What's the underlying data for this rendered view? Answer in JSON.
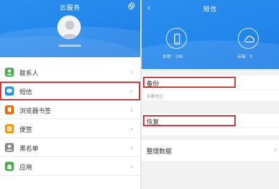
{
  "left_panel": {
    "title": "云服务",
    "menu": [
      {
        "label": "联系人",
        "icon": "contacts-icon",
        "color": "#4caf50"
      },
      {
        "label": "短信",
        "icon": "sms-icon",
        "color": "#2196f3"
      },
      {
        "label": "浏览器书签",
        "icon": "bookmark-icon",
        "color": "#ef6c00"
      },
      {
        "label": "便签",
        "icon": "note-icon",
        "color": "#ff9800"
      },
      {
        "label": "黑名单",
        "icon": "blacklist-icon",
        "color": "#8c8c8c"
      },
      {
        "label": "应用",
        "icon": "apps-icon",
        "color": "#4caf50"
      }
    ],
    "selected_index": 1
  },
  "right_panel": {
    "title": "短信",
    "local_count": "本地：198",
    "cloud_count": "云端：0",
    "backup_label": "备份",
    "backup_status": "未备份过",
    "restore_label": "恢复",
    "organize_label": "整理数据"
  },
  "colors": {
    "header_blue": "#1e7fe6",
    "highlight_red": "#d03a3a"
  }
}
